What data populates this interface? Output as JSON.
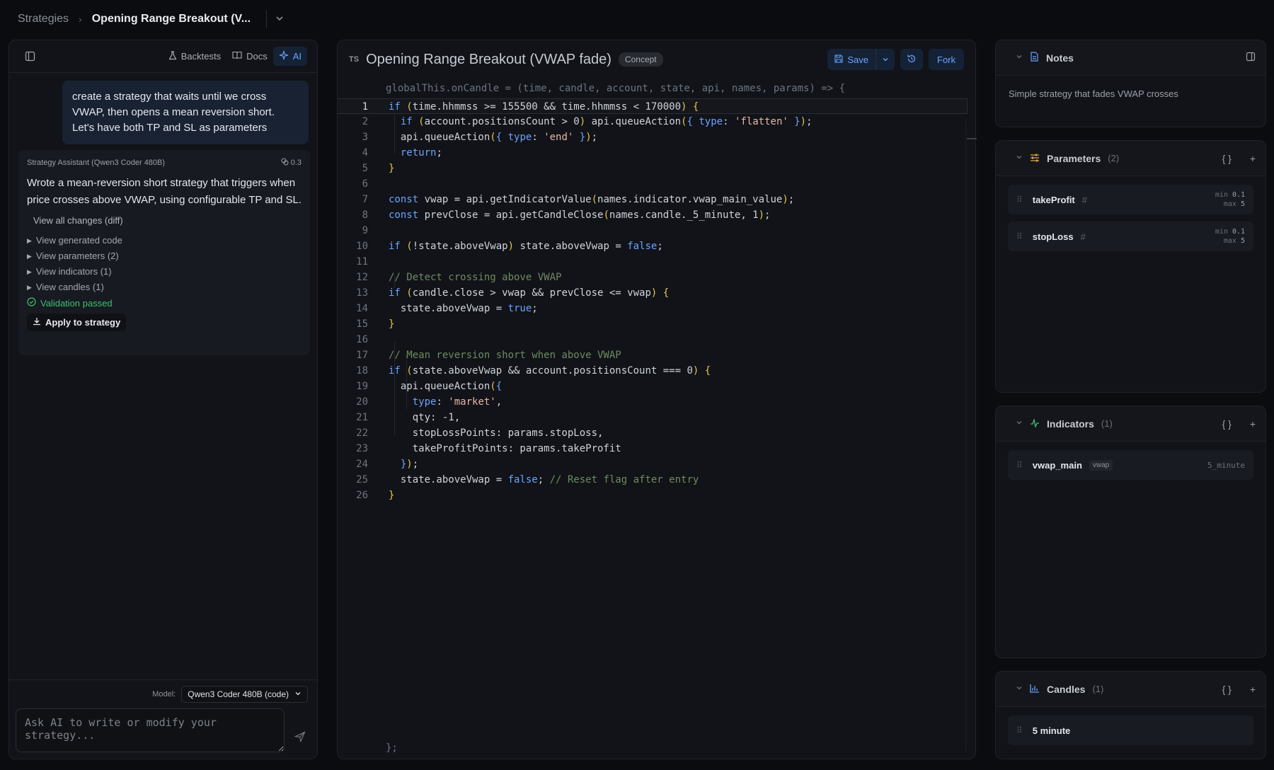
{
  "breadcrumb": {
    "root": "Strategies",
    "current": "Opening Range Breakout (V..."
  },
  "left_toolbar": {
    "backtests": "Backtests",
    "docs": "Docs",
    "ai": "AI"
  },
  "chat": {
    "user_message": "create a strategy that waits until we cross VWAP, then opens a mean reversion short. Let's have both TP and SL as parameters",
    "assistant": {
      "name": "Strategy Assistant (Qwen3 Coder 480B)",
      "cost": "0.3",
      "message": "Wrote a mean-reversion short strategy that triggers when price crosses above VWAP, using configurable TP and SL.",
      "view_diff": "View all changes (diff)",
      "items": [
        "View generated code",
        "View parameters (2)",
        "View indicators (1)",
        "View candles (1)"
      ],
      "validation": "Validation passed",
      "apply": "Apply to strategy"
    },
    "model_label": "Model:",
    "model_value": "Qwen3 Coder 480B (code)",
    "input_placeholder": "Ask AI to write or modify your strategy..."
  },
  "editor": {
    "lang": "TS",
    "title": "Opening Range Breakout (VWAP fade)",
    "badge": "Concept",
    "save": "Save",
    "fork": "Fork",
    "header_line": "globalThis.onCandle = (time, candle, account, state, api, names, params) => {",
    "footer_line": "};"
  },
  "notes": {
    "title": "Notes",
    "text": "Simple strategy that fades VWAP crosses"
  },
  "parameters": {
    "title": "Parameters",
    "count": "(2)",
    "items": [
      {
        "name": "takeProfit",
        "min_label": "min",
        "min": "0.1",
        "max_label": "max",
        "max": "5"
      },
      {
        "name": "stopLoss",
        "min_label": "min",
        "min": "0.1",
        "max_label": "max",
        "max": "5"
      }
    ]
  },
  "indicators": {
    "title": "Indicators",
    "count": "(1)",
    "items": [
      {
        "name": "vwap_main",
        "tag": "vwap",
        "timeframe": "5_minute"
      }
    ]
  },
  "candles": {
    "title": "Candles",
    "count": "(1)",
    "items": [
      {
        "name": "5 minute"
      }
    ]
  },
  "icons": {
    "sidebar_toggle": "sidebar-toggle-icon",
    "flask": "flask-icon",
    "book": "book-icon",
    "sparkle": "sparkle-icon",
    "save": "floppy-icon",
    "history": "history-icon",
    "send": "send-icon",
    "file": "file-icon",
    "sliders": "sliders-icon",
    "pulse": "pulse-icon",
    "bar_chart": "bar-chart-icon"
  },
  "colors": {
    "accent": "#6aa3ff",
    "success": "#3fbf73",
    "keyword": "#6aa3ff",
    "string": "#e8b6a3",
    "comment": "#6f8a5f",
    "bracket": "#e5c64a"
  }
}
